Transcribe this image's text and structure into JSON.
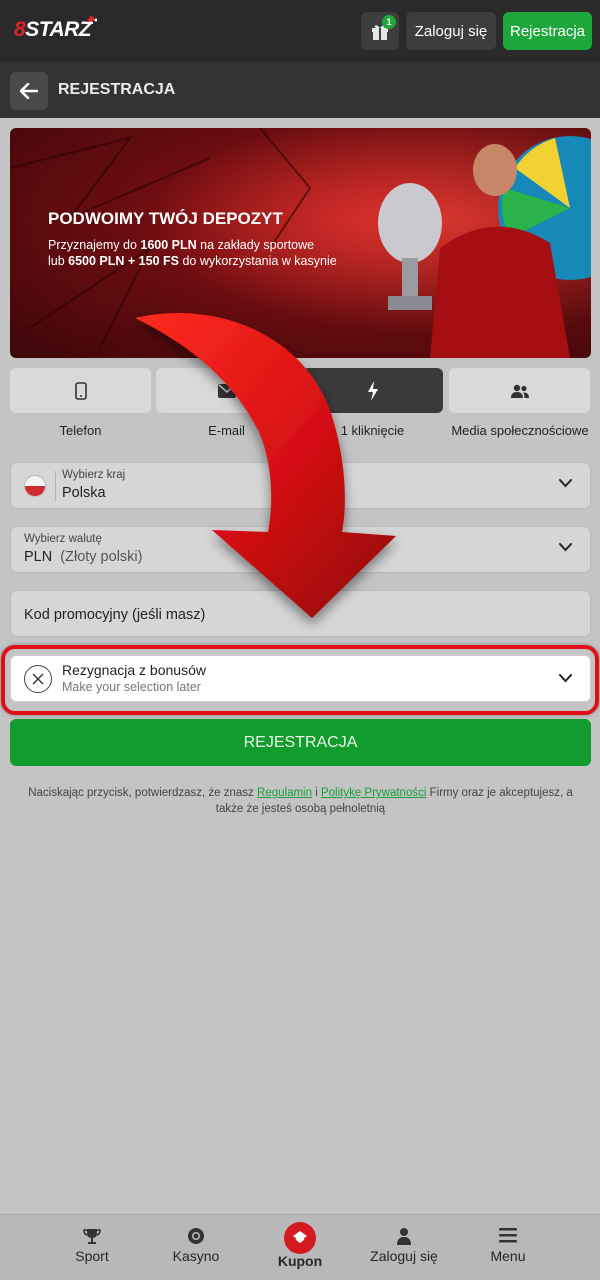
{
  "header": {
    "logo_prefix": "8",
    "logo_text": "STARZ",
    "gift_badge": "1",
    "login_label": "Zaloguj się",
    "register_label": "Rejestracja"
  },
  "subheader": {
    "title": "REJESTRACJA"
  },
  "banner": {
    "title": "PODWOIMY TWÓJ DEPOZYT",
    "line1_pre": "Przyznajemy do ",
    "line1_bold": "1600 PLN",
    "line1_post": " na zakłady sportowe",
    "line2_pre": "lub ",
    "line2_bold": "6500 PLN + 150 FS",
    "line2_post": " do wykorzystania w kasynie"
  },
  "methods": [
    {
      "label": "Telefon",
      "icon": "phone-icon"
    },
    {
      "label": "E-mail",
      "icon": "envelope-icon"
    },
    {
      "label": "1 kliknięcie",
      "icon": "lightning-icon"
    },
    {
      "label": "Media społecznościowe",
      "icon": "users-icon"
    }
  ],
  "form": {
    "country_label": "Wybierz kraj",
    "country_value": "Polska",
    "currency_label": "Wybierz walutę",
    "currency_code": "PLN",
    "currency_name": "(Złoty polski)",
    "promo_placeholder": "Kod promocyjny (jeśli masz)",
    "bonus_title": "Rezygnacja z bonusów",
    "bonus_subtitle": "Make your selection later",
    "submit_label": "REJESTRACJA"
  },
  "terms": {
    "pre": "Naciskając przycisk, potwierdzasz, że znasz ",
    "link1": "Regulamin",
    "mid": " i ",
    "link2": "Politykę Prywatności",
    "post": " Firmy oraz je akceptujesz, a także że jesteś osobą pełnoletnią"
  },
  "bottom_nav": [
    {
      "label": "Sport",
      "icon": "trophy-icon"
    },
    {
      "label": "Kasyno",
      "icon": "casino-chip-icon"
    },
    {
      "label": "Kupon",
      "icon": "ticket-icon"
    },
    {
      "label": "Zaloguj się",
      "icon": "user-icon"
    },
    {
      "label": "Menu",
      "icon": "hamburger-menu-icon"
    }
  ],
  "colors": {
    "brand_green": "#1ea83b",
    "brand_red": "#e10e17",
    "header_bg": "#2a2a2a"
  }
}
